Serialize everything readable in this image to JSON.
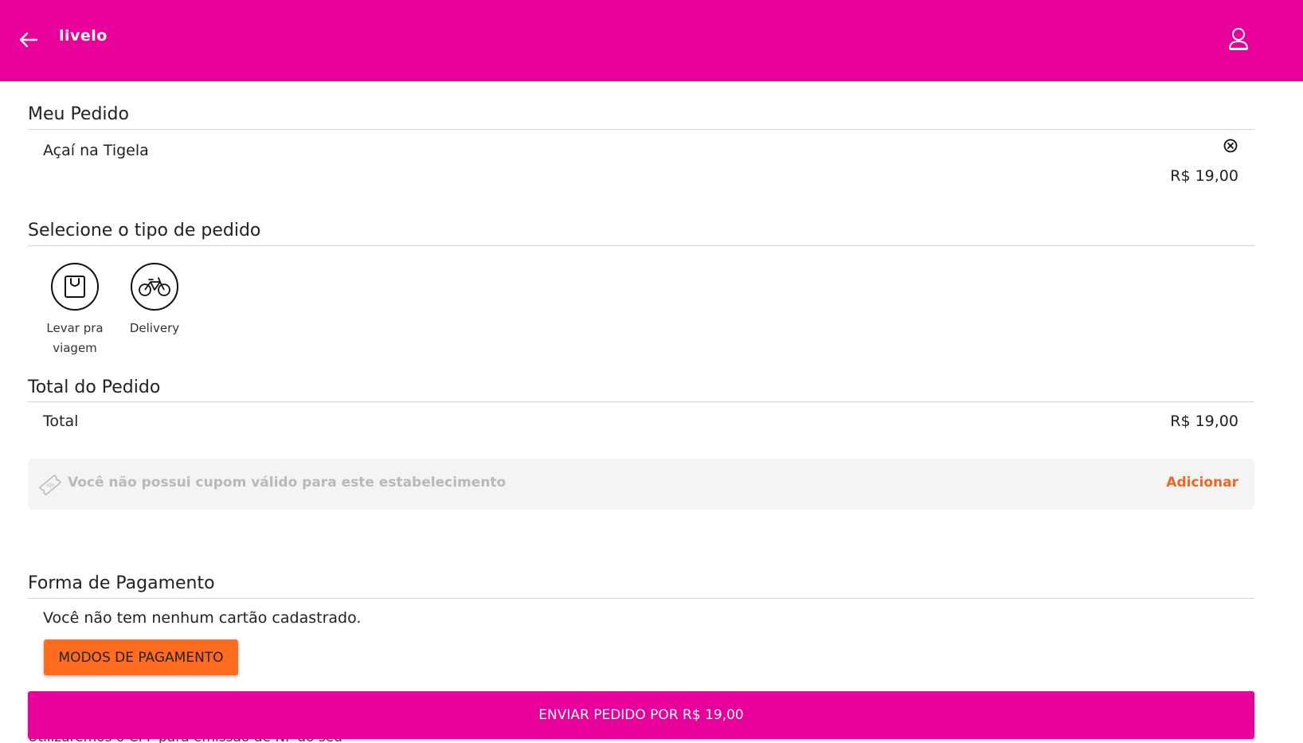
{
  "header": {
    "logo_text": "livelo",
    "back_icon": "arrow-left-icon",
    "user_icon": "user-icon",
    "background_color": "#e8009b"
  },
  "order": {
    "title": "Meu Pedido",
    "items": [
      {
        "name": "Açaí na Tigela",
        "price": "R$ 19,00",
        "remove_icon": "close-circle-icon"
      }
    ]
  },
  "order_type": {
    "title": "Selecione o tipo de pedido",
    "options": [
      {
        "label": "Levar pra viagem",
        "icon": "shopping-bag-icon"
      },
      {
        "label": "Delivery",
        "icon": "bicycle-icon"
      }
    ]
  },
  "total": {
    "title": "Total do Pedido",
    "label": "Total",
    "value": "R$ 19,00"
  },
  "coupon": {
    "icon": "coupon-ticket-icon",
    "message": "Você não possui cupom válido para este estabelecimento",
    "add_label": "Adicionar",
    "accent_color": "#f26522"
  },
  "payment": {
    "title": "Forma de Pagamento",
    "no_card_message": "Você não tem nenhum cartão cadastrado.",
    "modes_button_label": "MODOS DE PAGAMENTO",
    "button_color": "#ff6b1f"
  },
  "footer": {
    "nf_text": "Utilizaremos o CPF para emissão de NF do seu",
    "submit_label": "ENVIAR PEDIDO POR R$ 19,00"
  }
}
